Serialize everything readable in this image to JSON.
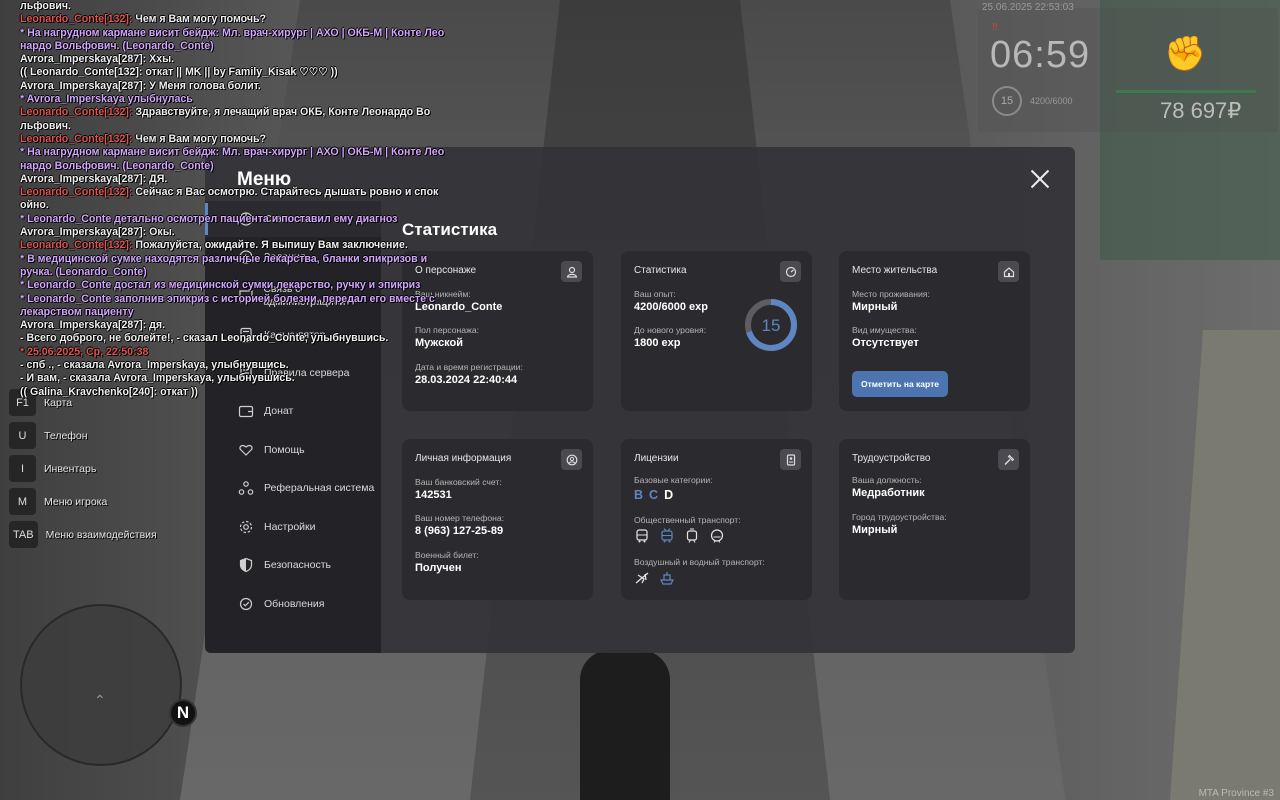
{
  "chat": [
    {
      "color": "white",
      "text": "льфович."
    },
    {
      "color": "red",
      "prefix": "Leonardo_Conte[132]: ",
      "text": "Чем я Вам могу помочь?"
    },
    {
      "color": "purple",
      "text": "* На нагрудном кармане висит бейдж: Мл. врач-хирург | АХО | ОКБ-М | Конте Лео"
    },
    {
      "color": "purple",
      "text": "нардо Вольфович. (Leonardo_Conte)"
    },
    {
      "color": "white",
      "text": "Avrora_Imperskaya[287]: Ххы."
    },
    {
      "color": "white",
      "text": "(( Leonardo_Conte[132]: откат || MK || by Family_Kisak ♡♡♡ ))"
    },
    {
      "color": "white",
      "text": "Avrora_Imperskaya[287]: У Меня голова болит."
    },
    {
      "color": "purple",
      "text": "* Avrora_Imperskaya улыбнулась"
    },
    {
      "color": "red",
      "prefix": "Leonardo_Conte[132]: ",
      "text": "Здравствуйте, я лечащий врач ОКБ, Конте Леонардо Во"
    },
    {
      "color": "white",
      "text": "льфович."
    },
    {
      "color": "red",
      "prefix": "Leonardo_Conte[132]: ",
      "text": "Чем я Вам могу помочь?"
    },
    {
      "color": "purple",
      "text": "* На нагрудном кармане висит бейдж: Мл. врач-хирург | АХО | ОКБ-М | Конте Лео"
    },
    {
      "color": "purple",
      "text": "нардо Вольфович. (Leonardo_Conte)"
    },
    {
      "color": "white",
      "text": "Avrora_Imperskaya[287]: ДЯ."
    },
    {
      "color": "red",
      "prefix": "Leonardo_Conte[132]: ",
      "text": "Сейчас я Вас осмотрю. Старайтесь дышать ровно и спок"
    },
    {
      "color": "white",
      "text": "ойно."
    },
    {
      "color": "purple",
      "text": "* Leonardo_Conte детально осмотрел пациента и поставил ему диагноз"
    },
    {
      "color": "white",
      "text": "Avrora_Imperskaya[287]: Окы."
    },
    {
      "color": "red",
      "prefix": "Leonardo_Conte[132]: ",
      "text": "Пожалуйста, ожидайте. Я выпишу Вам заключение."
    },
    {
      "color": "purple",
      "text": "* В медицинской сумке находятся различные лекарства, бланки эпикризов и"
    },
    {
      "color": "purple",
      "text": "ручка. (Leonardo_Conte)"
    },
    {
      "color": "purple",
      "text": "* Leonardo_Conte достал из медицинской сумки лекарство, ручку и эпикриз"
    },
    {
      "color": "purple",
      "text": "* Leonardo_Conte заполнив эпикриз с историей болезни, передал его вместе с"
    },
    {
      "color": "purple",
      "text": "лекарством пациенту"
    },
    {
      "color": "white",
      "text": "Avrora_Imperskaya[287]: дя."
    },
    {
      "color": "white",
      "text": "- Всего доброго, не болейте!, - сказал Leonardo_Conte, улыбнувшись."
    },
    {
      "color": "red",
      "text": "* 25.06.2025, Ср, 22:50:38"
    },
    {
      "color": "white",
      "text": "- спб ., - сказала Avrora_Imperskaya, улыбнувшись."
    },
    {
      "color": "white",
      "text": "- И вам, - сказала Avrora_Imperskaya, улыбнувшись."
    },
    {
      "color": "white",
      "text": "(( Galina_Kravchenko[240]: откат ))"
    }
  ],
  "hotkeys": [
    {
      "key": "F1",
      "label": "Карта"
    },
    {
      "key": "U",
      "label": "Телефон"
    },
    {
      "key": "I",
      "label": "Инвентарь"
    },
    {
      "key": "M",
      "label": "Меню игрока"
    },
    {
      "key": "TAB",
      "label": "Меню взаимодействия"
    }
  ],
  "minimap": {
    "north": "N"
  },
  "hud": {
    "datetime": "25.06.2025 22:53:03",
    "wanted": "!!",
    "time": "06:59",
    "level": "15",
    "exp": "4200/6000",
    "money": "78 697₽",
    "health_bar_fill": 1.0
  },
  "menu": {
    "title": "Меню",
    "content_title": "Статистика",
    "sidebar": [
      {
        "label": "Статистика",
        "icon": "chart-icon",
        "active": true
      },
      {
        "label": "Задания",
        "icon": "star-icon",
        "active": false
      },
      {
        "label": "Связь с администрацией",
        "icon": "chat-icon",
        "active": false
      },
      {
        "label": "Калькулятор",
        "icon": "calculator-icon",
        "active": false
      },
      {
        "label": "Правила сервера",
        "icon": "document-icon",
        "active": false
      },
      {
        "label": "Донат",
        "icon": "wallet-icon",
        "active": false
      },
      {
        "label": "Помощь",
        "icon": "heart-hand-icon",
        "active": false
      },
      {
        "label": "Реферальная система",
        "icon": "referral-icon",
        "active": false
      },
      {
        "label": "Настройки",
        "icon": "gear-icon",
        "active": false
      },
      {
        "label": "Безопасность",
        "icon": "shield-icon",
        "active": false
      },
      {
        "label": "Обновления",
        "icon": "refresh-icon",
        "active": false
      }
    ],
    "cards": {
      "character": {
        "title": "О персонаже",
        "nickname_label": "Ваш никнейм:",
        "nickname": "Leonardo_Conte",
        "gender_label": "Пол персонажа:",
        "gender": "Мужской",
        "reg_label": "Дата и время регистрации:",
        "reg": "28.03.2024 22:40:44"
      },
      "stats": {
        "title": "Статистика",
        "exp_label": "Ваш опыт:",
        "exp": "4200/6000 exp",
        "next_label": "До нового уровня:",
        "next": "1800 exp",
        "level": "15",
        "progress": 0.7
      },
      "residence": {
        "title": "Место жительства",
        "place_label": "Место проживания:",
        "place": "Мирный",
        "property_label": "Вид имущества:",
        "property": "Отсутствует",
        "map_button": "Отметить на карте"
      },
      "personal": {
        "title": "Личная информация",
        "account_label": "Ваш банковский счет:",
        "account": "142531",
        "phone_label": "Ваш номер телефона:",
        "phone": "8 (963) 127-25-89",
        "military_label": "Военный билет:",
        "military": "Получен"
      },
      "licenses": {
        "title": "Лицензии",
        "base_label": "Базовые категории:",
        "categories": [
          {
            "name": "B",
            "owned": true
          },
          {
            "name": "C",
            "owned": true
          },
          {
            "name": "D",
            "owned": false
          }
        ],
        "public_label": "Общественный транспорт:",
        "public_icons": [
          {
            "icon": "bus-icon",
            "owned": false
          },
          {
            "icon": "trolleybus-icon",
            "owned": true
          },
          {
            "icon": "tram-icon",
            "owned": false
          },
          {
            "icon": "metro-icon",
            "owned": false
          }
        ],
        "air_label": "Воздушный и водный транспорт:",
        "air_icons": [
          {
            "icon": "plane-icon",
            "owned": false
          },
          {
            "icon": "boat-icon",
            "owned": true
          }
        ]
      },
      "employment": {
        "title": "Трудоустройство",
        "position_label": "Ваша должность:",
        "position": "Медработник",
        "city_label": "Город трудоустройства:",
        "city": "Мирный"
      }
    }
  },
  "watermark": "MTA Province #3",
  "colors": {
    "accent": "#5f86c2",
    "card": "#2b2b2f",
    "sidebar": "#232327",
    "chat_red": "#e05353",
    "chat_purple": "#d3a6ff"
  }
}
